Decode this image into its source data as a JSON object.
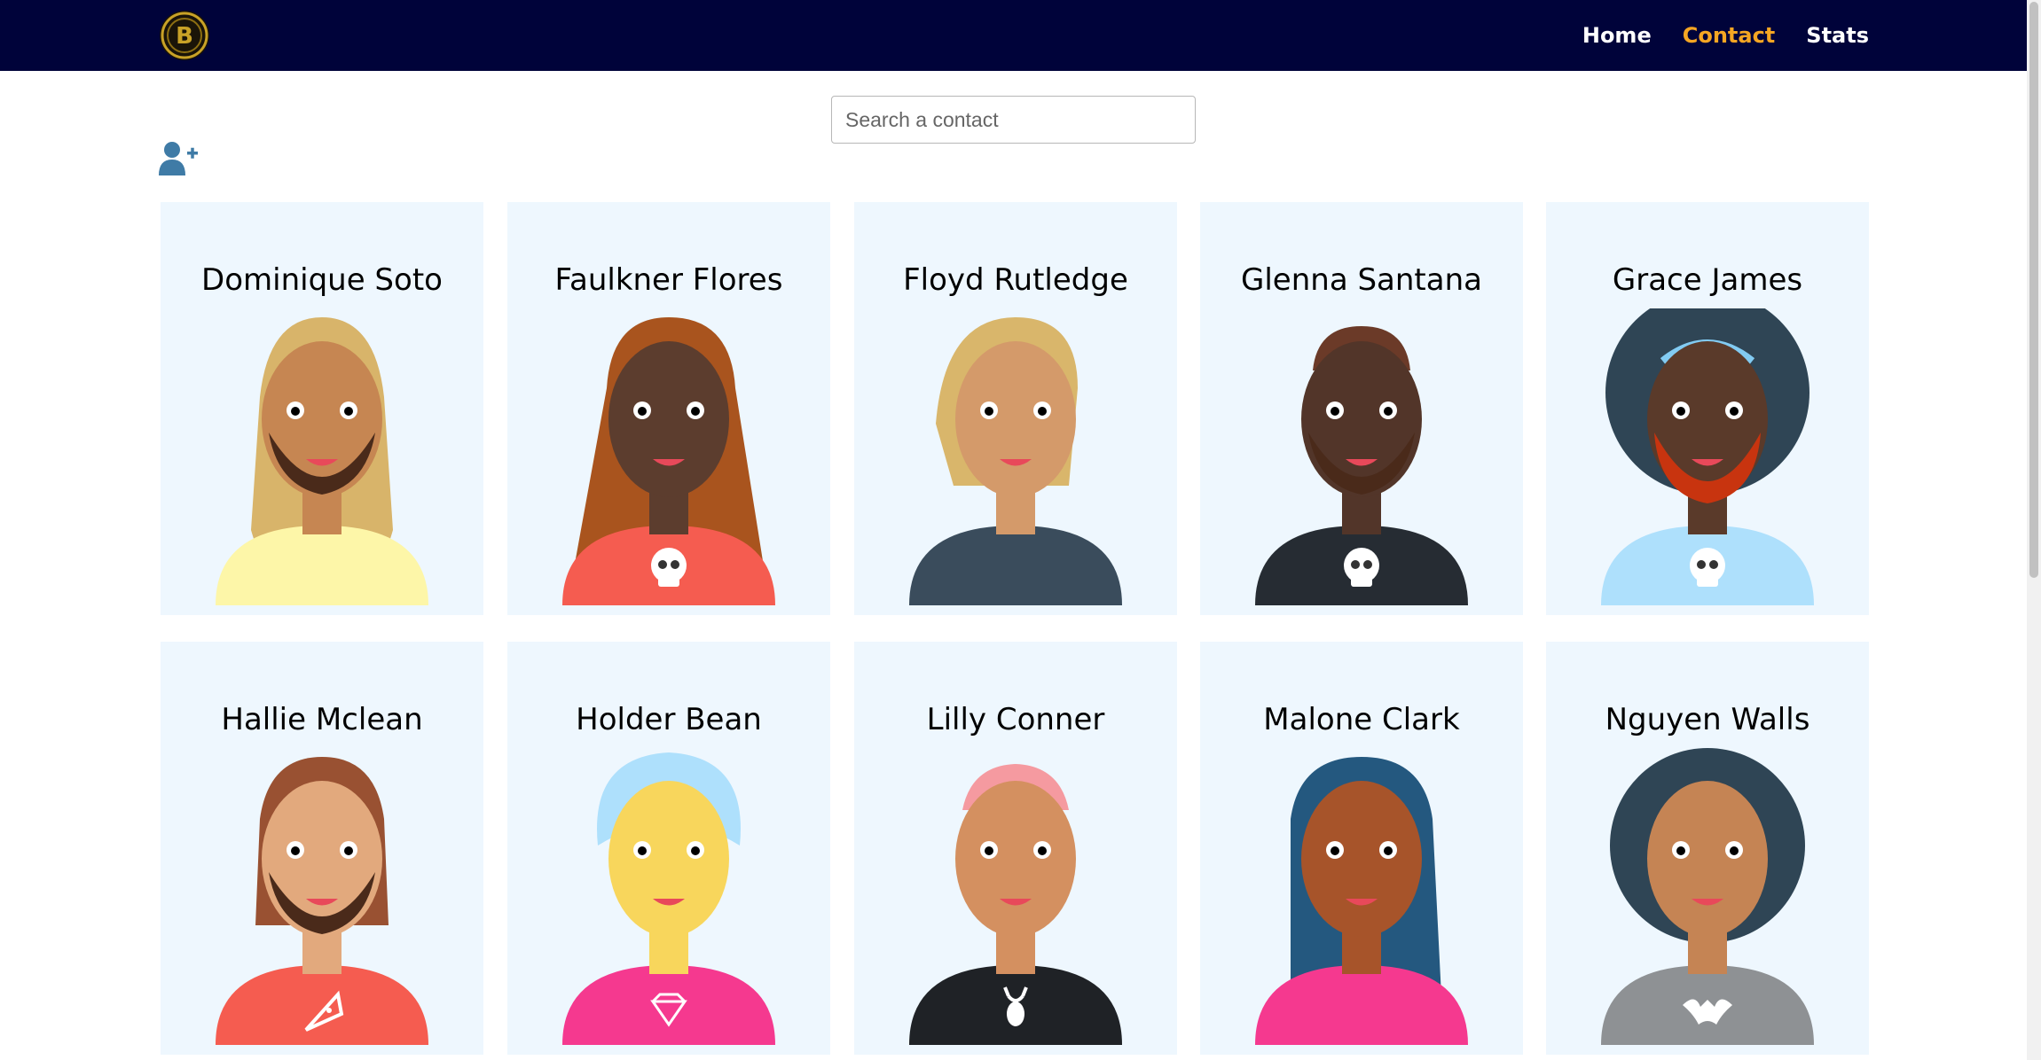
{
  "nav": {
    "logo_icon": "bitcoin-logo",
    "links": [
      {
        "label": "Home",
        "active": false
      },
      {
        "label": "Contact",
        "active": true
      },
      {
        "label": "Stats",
        "active": false
      }
    ],
    "active_color": "#f5a623",
    "background": "#00033a"
  },
  "search": {
    "placeholder": "Search a contact",
    "value": ""
  },
  "add_contact_icon": "add-user-icon",
  "contacts": [
    {
      "name": "Dominique Soto",
      "skin": "#c68652",
      "hair": "#d8b46a",
      "shirt": "#fdf6a8",
      "emblem": "none",
      "style": "long-dreads-beard"
    },
    {
      "name": "Faulkner Flores",
      "skin": "#5c3d2e",
      "hair": "#a9541e",
      "shirt": "#f55c50",
      "emblem": "skull-icon",
      "style": "long-hair"
    },
    {
      "name": "Floyd Rutledge",
      "skin": "#d49a6a",
      "hair": "#d9b66b",
      "shirt": "#3a4c5c",
      "emblem": "none",
      "style": "bob-hair"
    },
    {
      "name": "Glenna Santana",
      "skin": "#523529",
      "hair": "#6b3a28",
      "shirt": "#262c33",
      "emblem": "skull-icon",
      "style": "bald-beard"
    },
    {
      "name": "Grace James",
      "skin": "#5a3a2a",
      "hair": "#2f4555",
      "shirt": "#aee0fc",
      "emblem": "skull-icon",
      "style": "afro-red-beard"
    },
    {
      "name": "Hallie Mclean",
      "skin": "#e2a97d",
      "hair": "#995132",
      "shirt": "#f55c50",
      "emblem": "pizza-icon",
      "style": "shoulder-hair-beard"
    },
    {
      "name": "Holder Bean",
      "skin": "#f8d65c",
      "hair": "#aee0fc",
      "shirt": "#f5398f",
      "emblem": "diamond-icon",
      "style": "turban-mustache"
    },
    {
      "name": "Lilly Conner",
      "skin": "#d49060",
      "hair": "#f59aa0",
      "shirt": "#1f2226",
      "emblem": "deer-icon",
      "style": "short-pink-mustache"
    },
    {
      "name": "Malone Clark",
      "skin": "#a7542a",
      "hair": "#24587f",
      "shirt": "#f5398f",
      "emblem": "none",
      "style": "hijab-grimace"
    },
    {
      "name": "Nguyen Walls",
      "skin": "#c58454",
      "hair": "#2f4555",
      "shirt": "#8e9194",
      "emblem": "bat-icon",
      "style": "curly-hair-x-eyes"
    }
  ]
}
